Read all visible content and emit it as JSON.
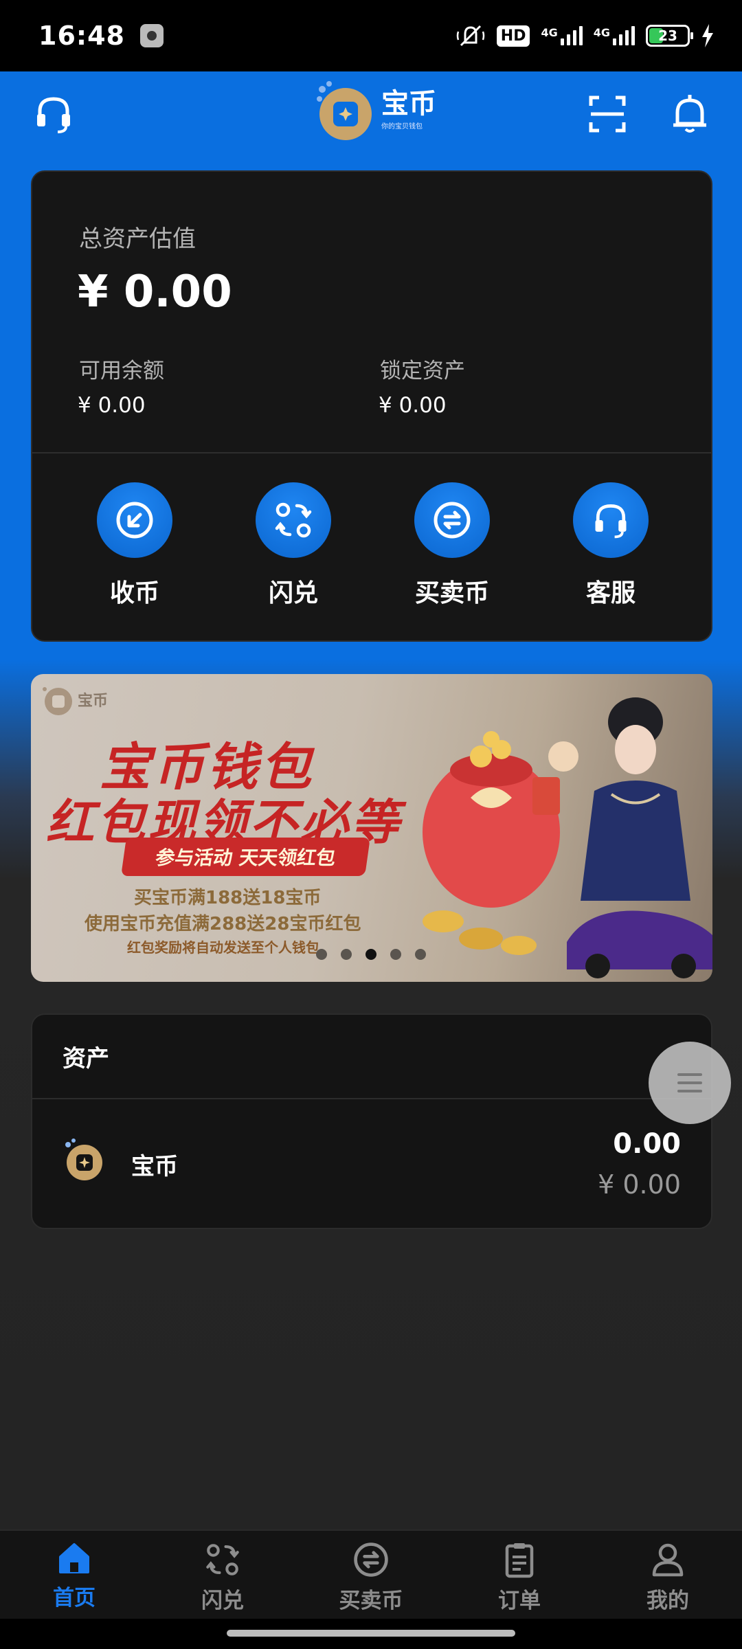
{
  "status_bar": {
    "time": "16:48",
    "hd_label": "HD",
    "net1": "4G",
    "net2": "4G",
    "battery": "23"
  },
  "header": {
    "app_name": "宝币",
    "app_slogan": "你的宝贝钱包",
    "icons": [
      "headset-icon",
      "scan-icon",
      "bell-icon"
    ]
  },
  "asset_card": {
    "total_label": "总资产估值",
    "total_value": "¥ 0.00",
    "available_label": "可用余额",
    "available_value": "¥ 0.00",
    "locked_label": "锁定资产",
    "locked_value": "¥ 0.00",
    "actions": [
      {
        "label": "收币",
        "icon": "receive-icon"
      },
      {
        "label": "闪兑",
        "icon": "swap-icon"
      },
      {
        "label": "买卖币",
        "icon": "exchange-icon"
      },
      {
        "label": "客服",
        "icon": "headset-icon"
      }
    ]
  },
  "banner": {
    "logo_text": "宝币",
    "headline1": "宝币钱包",
    "headline2": "红包现领不必等",
    "pill": "参与活动  天天领红包",
    "line1": "买宝币满188送18宝币",
    "line2": "使用宝币充值满288送28宝币红包",
    "line3": "红包奖励将自动发送至个人钱包",
    "dots": 5,
    "active_dot": 2
  },
  "assets": {
    "title": "资产",
    "items": [
      {
        "name": "宝币",
        "amount": "0.00",
        "cny": "¥ 0.00"
      }
    ]
  },
  "bottom_nav": {
    "items": [
      {
        "label": "首页",
        "icon": "home-icon",
        "active": true
      },
      {
        "label": "闪兑",
        "icon": "swap-icon",
        "active": false
      },
      {
        "label": "买卖币",
        "icon": "exchange-icon",
        "active": false
      },
      {
        "label": "订单",
        "icon": "order-icon",
        "active": false
      },
      {
        "label": "我的",
        "icon": "user-icon",
        "active": false
      }
    ]
  },
  "colors": {
    "accent": "#1a7bf0",
    "header_blue": "#0a6fe0",
    "card_bg": "#161616",
    "banner_red": "#c62424"
  }
}
